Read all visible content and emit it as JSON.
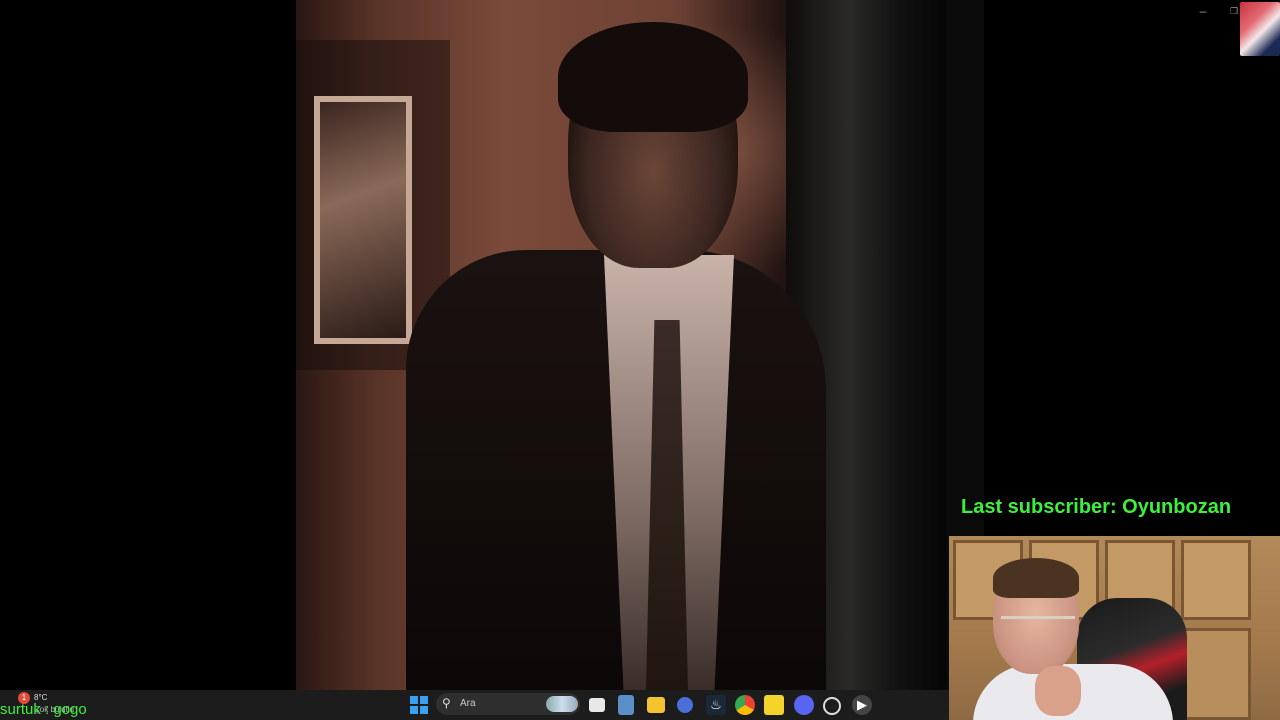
{
  "overlay": {
    "last_subscriber": "Last subscriber: Oyunbozan"
  },
  "chat": {
    "line": "surtuk : gogo"
  },
  "weather": {
    "temp": "8°C",
    "desc": "Çok bulutlu",
    "badge": "1"
  },
  "taskbar": {
    "search_placeholder": "Ara",
    "apps": [
      "start-icon",
      "search",
      "task-view-icon",
      "calculator-icon",
      "file-explorer-icon",
      "browser-icon",
      "steam-icon",
      "chrome-icon",
      "sticky-notes-icon",
      "discord-icon",
      "app-icon",
      "media-player-icon"
    ]
  },
  "colors": {
    "overlay_green": "#3ef03e",
    "taskbar": "#1c1c1c"
  }
}
